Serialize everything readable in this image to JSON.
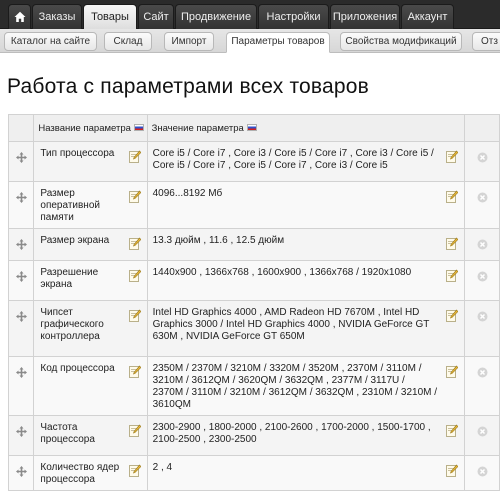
{
  "top_nav": {
    "home_icon": "home-icon",
    "tabs": [
      {
        "label": "Заказы"
      },
      {
        "label": "Товары"
      },
      {
        "label": "Сайт"
      },
      {
        "label": "Продвижение"
      },
      {
        "label": "Настройки"
      },
      {
        "label": "Приложения"
      },
      {
        "label": "Аккаунт"
      }
    ],
    "active_tab": "Товары"
  },
  "sub_nav": {
    "tabs": [
      {
        "label": "Каталог на сайте"
      },
      {
        "label": "Склад"
      },
      {
        "label": "Импорт"
      },
      {
        "label": "Параметры товаров"
      },
      {
        "label": "Свойства модификаций"
      },
      {
        "label": "Отз"
      }
    ],
    "active_tab": "Параметры товаров"
  },
  "page": {
    "title": "Работа с параметрами всех товаров"
  },
  "table": {
    "columns": [
      "Название параметра",
      "Значение параметра"
    ],
    "rows": [
      {
        "name": "Тип процессора",
        "value": "Core i5 / Core i7 , Core i3 / Core i5 / Core i7 , Core i3 / Core i5 / Core i5 / Core i7 , Core i5 / Core i7 , Core i3 / Core i5"
      },
      {
        "name": "Размер оперативной памяти",
        "value": "4096...8192 Мб"
      },
      {
        "name": "Размер экрана",
        "value": "13.3 дюйм , 11.6 , 12.5 дюйм"
      },
      {
        "name": "Разрешение экрана",
        "value": "1440x900 , 1366x768 , 1600x900 , 1366x768 / 1920x1080"
      },
      {
        "name": "Чипсет графического контроллера",
        "value": "Intel HD Graphics 4000 , AMD Radeon HD 7670M , Intel HD Graphics 3000 / Intel HD Graphics 4000 , NVIDIA GeForce GT 630M , NVIDIA GeForce GT 650M"
      },
      {
        "name": "Код процессора",
        "value": "2350M / 2370M / 3210M / 3320M / 3520M , 2370M / 3110M / 3210M / 3612QM / 3620QM / 3632QM , 2377M / 3117U / 2370M / 3110M / 3210M / 3612QM / 3632QM , 2310M / 3210M / 3610QM"
      },
      {
        "name": "Частота процессора",
        "value": "2300-2900 , 1800-2000 , 2100-2600 , 1700-2000 , 1500-1700 , 2100-2500 , 2300-2500"
      },
      {
        "name": "Количество ядер процессора",
        "value": "2 , 4"
      }
    ]
  },
  "icons": {
    "drag": "drag-handle-icon",
    "edit": "edit-icon",
    "delete": "delete-icon",
    "flag": "ru-flag-icon"
  },
  "colors": {
    "topbar": "#2b2b2b",
    "active_tab": "#f2f2f2",
    "table_border": "#d2d2d2"
  }
}
